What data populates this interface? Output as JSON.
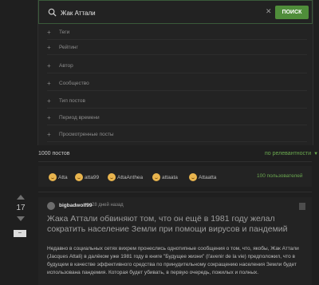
{
  "search": {
    "value": "Жак Аттали",
    "button_label": "ПОИСК"
  },
  "filters": [
    "Теги",
    "Рейтинг",
    "Автор",
    "Сообщество",
    "Тип постов",
    "Период времени",
    "Просмотренные посты"
  ],
  "results": {
    "count_label": "1000 постов",
    "sort_label": "по релевантности"
  },
  "users": {
    "list": [
      "Atta",
      "atta99",
      "AttaAnthea",
      "attaata",
      "Attaatta"
    ],
    "count_label": "100 пользователей"
  },
  "post": {
    "rating": "17",
    "author": "bigbadwolf99",
    "time": "28 дней назад",
    "title": "Жака Аттали обвиняют том, что он ещё в 1981 году желал сократить население Земли при помощи вирусов и пандемий",
    "body": "Недавно в социальных сетях вихрем пронеслись однотипные сообщения о том, что, якобы, Жак Аттали (Jacques Attali) в далёком уже 1981 году в книге \"Будущее жизни\" (l'avenir de la vie) предположил, что в будущем в качестве эффективного средства по принудительному сокращению населения Земли будет использована пандемия. Которая будет убивать, в первую очередь, пожилых и полных."
  }
}
